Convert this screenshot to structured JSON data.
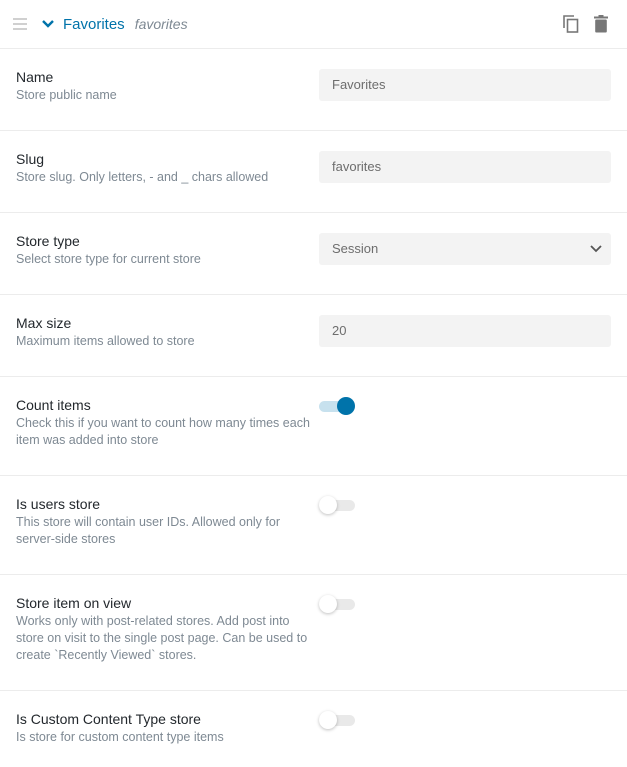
{
  "header": {
    "title": "Favorites",
    "slug": "favorites",
    "icons": [
      "drag-handle-icon",
      "chevron-down-icon",
      "copy-icon",
      "trash-icon"
    ],
    "accent_color": "#0073aa"
  },
  "fields": {
    "name": {
      "label": "Name",
      "description": "Store public name",
      "value": "Favorites"
    },
    "slug": {
      "label": "Slug",
      "description": "Store slug. Only letters, - and _ chars allowed",
      "value": "favorites"
    },
    "store_type": {
      "label": "Store type",
      "description": "Select store type for current store",
      "value": "Session"
    },
    "max_size": {
      "label": "Max size",
      "description": "Maximum items allowed to store",
      "value": "20"
    },
    "count_items": {
      "label": "Count items",
      "description": "Check this if you want to count how many times each item was added into store",
      "checked": true
    },
    "is_users_store": {
      "label": "Is users store",
      "description": "This store will contain user IDs. Allowed only for server-side stores",
      "checked": false
    },
    "store_item_on_view": {
      "label": "Store item on view",
      "description": "Works only with post-related stores. Add post into store on visit to the single post page. Can be used to create `Recently Viewed` stores.",
      "checked": false
    },
    "is_cct_store": {
      "label": "Is Custom Content Type store",
      "description": "Is store for custom content type items",
      "checked": false
    }
  }
}
